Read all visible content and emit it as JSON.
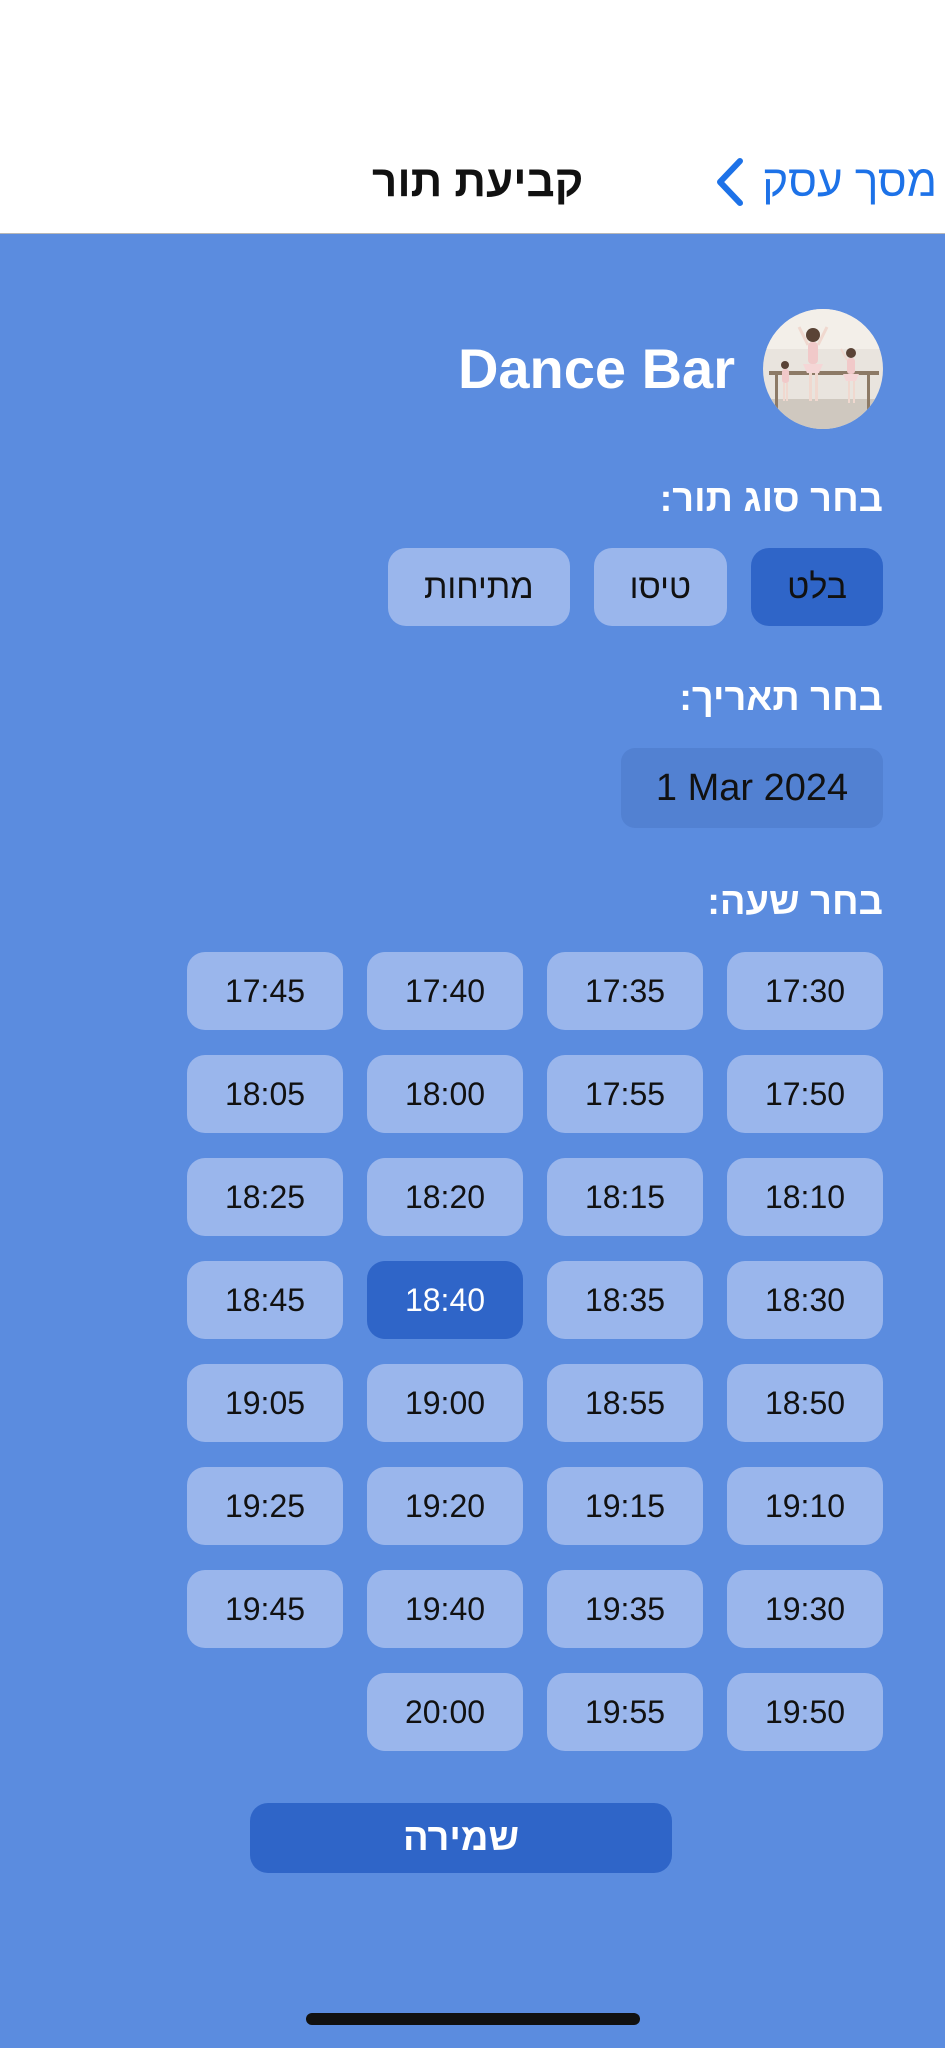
{
  "nav": {
    "back_label": "מסך עסק",
    "title": "קביעת תור"
  },
  "business": {
    "name": "Dance Bar",
    "avatar_icon": "ballet-dancers-photo"
  },
  "appointment_type": {
    "label": "בחר סוג תור:",
    "options": [
      "בלט",
      "טיסו",
      "מתיחות"
    ],
    "selected": "בלט"
  },
  "date": {
    "label": "בחר תאריך:",
    "value": "1 Mar 2024"
  },
  "time": {
    "label": "בחר שעה:",
    "rows": [
      [
        "17:30",
        "17:35",
        "17:40",
        "17:45"
      ],
      [
        "17:50",
        "17:55",
        "18:00",
        "18:05"
      ],
      [
        "18:10",
        "18:15",
        "18:20",
        "18:25"
      ],
      [
        "18:30",
        "18:35",
        "18:40",
        "18:45"
      ],
      [
        "18:50",
        "18:55",
        "19:00",
        "19:05"
      ],
      [
        "19:10",
        "19:15",
        "19:20",
        "19:25"
      ],
      [
        "19:30",
        "19:35",
        "19:40",
        "19:45"
      ],
      [
        "19:50",
        "19:55",
        "20:00"
      ]
    ],
    "selected": "18:40"
  },
  "save_label": "שמירה",
  "colors": {
    "background": "#5B8CDF",
    "chip": "#9AB6EC",
    "selected": "#2F65C8",
    "link": "#1D72E8"
  }
}
